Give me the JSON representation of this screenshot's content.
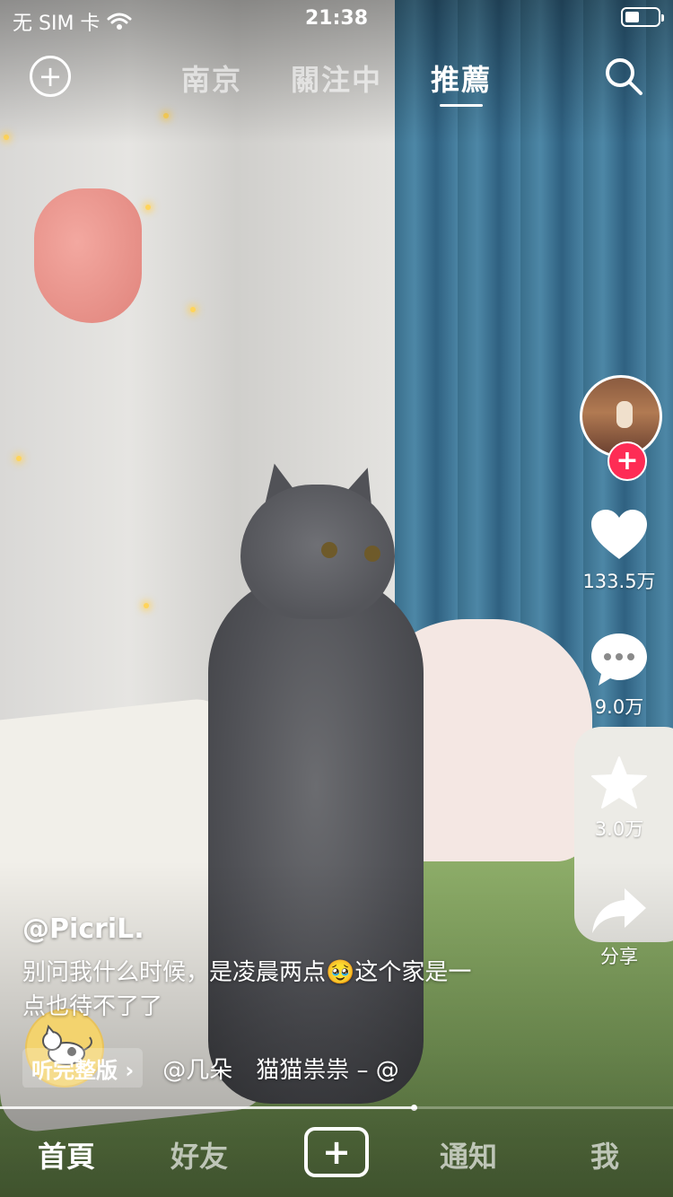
{
  "status_bar": {
    "carrier": "无 SIM 卡",
    "time": "21:38",
    "battery_level": 0.45
  },
  "top_nav": {
    "tabs": [
      {
        "label": "南京",
        "active": false
      },
      {
        "label": "關注中",
        "active": false
      },
      {
        "label": "推薦",
        "active": true
      }
    ],
    "left_icon": "add-circle-icon",
    "right_icon": "search-icon"
  },
  "right_rail": {
    "avatar_icon": "author-avatar",
    "follow_icon": "plus-icon",
    "like": {
      "icon": "heart-icon",
      "count": "133.5万"
    },
    "comment": {
      "icon": "comment-bubble-icon",
      "count": "9.0万"
    },
    "favorite": {
      "icon": "star-icon",
      "count": "3.0万"
    },
    "share": {
      "icon": "share-arrow-icon",
      "label": "分享"
    },
    "music_disc_icon": "music-disc-cat"
  },
  "caption": {
    "author": "@PicriL.",
    "description": "别问我什么时候，是凌晨两点🥹这个家是一点也待不了了",
    "listen_button": "听完整版",
    "music_text": "@几朵　猫猫祟祟 – @"
  },
  "progress": {
    "value": 0.615
  },
  "bottom_nav": {
    "items": [
      {
        "label": "首頁",
        "active": true
      },
      {
        "label": "好友",
        "active": false
      },
      {
        "label": "+",
        "active": false
      },
      {
        "label": "通知",
        "active": false
      },
      {
        "label": "我",
        "active": false
      }
    ]
  },
  "colors": {
    "follow_red": "#fe2c55",
    "curtain_blue": "#3a6f8c",
    "bed_green": "#8fae6a"
  }
}
